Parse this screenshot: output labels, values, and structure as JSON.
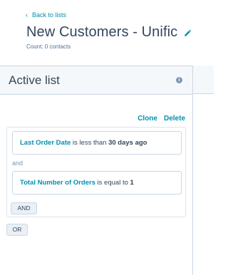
{
  "header": {
    "back_label": "Back to lists",
    "title": "New Customers - Unific",
    "count": "Count: 0 contacts"
  },
  "panel": {
    "title": "Active list",
    "info_icon": "i",
    "actions": {
      "clone": "Clone",
      "delete": "Delete"
    }
  },
  "filters": [
    {
      "property": "Last Order Date",
      "operator": " is less than ",
      "value": "30 days ago"
    },
    {
      "property": "Total Number of Orders",
      "operator": " is equal to ",
      "value": "1"
    }
  ],
  "connector": "and",
  "buttons": {
    "and": "AND",
    "or": "OR"
  },
  "colors": {
    "link": "#0091ae",
    "text": "#33475b",
    "border": "#cbd6e2"
  },
  "icons": {
    "back": "chevron-left-icon",
    "edit": "pencil-icon",
    "info": "info-icon"
  }
}
